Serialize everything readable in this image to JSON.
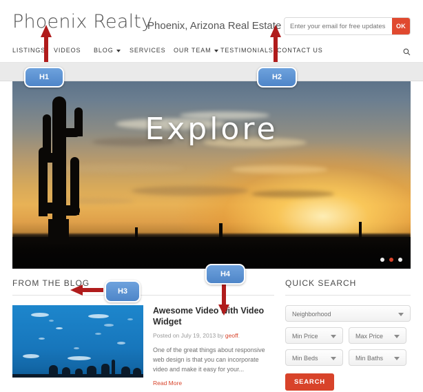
{
  "site": {
    "logo": "Phoenix Realty",
    "tagline": "Phoenix, Arizona Real Estate"
  },
  "signup": {
    "placeholder": "Enter your email for free updates",
    "value": "",
    "button_label": "OK",
    "button_color": "#e0492f"
  },
  "nav": {
    "items": [
      {
        "label": "LISTINGS",
        "has_caret": false
      },
      {
        "label": "VIDEOS",
        "has_caret": false
      },
      {
        "label": "BLOG",
        "has_caret": true
      },
      {
        "label": "SERVICES",
        "has_caret": false
      },
      {
        "label": "OUR TEAM",
        "has_caret": true
      },
      {
        "label": "TESTIMONIALS",
        "has_caret": false
      },
      {
        "label": "CONTACT US",
        "has_caret": false
      }
    ],
    "search_icon": "search-icon"
  },
  "hero": {
    "headline": "Explore",
    "slides_total": 3,
    "active_slide": 2,
    "active_dot_color": "#d8432a"
  },
  "blog": {
    "section_title": "From the Blog",
    "post": {
      "thumbnail_alt": "aquarium-video-thumbnail",
      "title": "Awesome Video with Video Widget",
      "meta_prefix": "Posted on July 19, 2013 by ",
      "meta_author": "geoff",
      "meta_suffix": ".",
      "excerpt": "One of the great things about responsive web design is that you can incorporate video and make it easy for your...",
      "read_more": "Read More"
    }
  },
  "quick_search": {
    "title": "Quick Search",
    "neighborhood": "Neighborhood",
    "min_price": "Min Price",
    "max_price": "Max Price",
    "min_beds": "Min Beds",
    "min_baths": "Min Baths",
    "search_label": "Search",
    "search_color": "#d8432a"
  },
  "annotations": {
    "badge_color": "#4e85c8",
    "arrow_color": "#b01c1c",
    "h1": "H1",
    "h2": "H2",
    "h3": "H3",
    "h4": "H4"
  }
}
